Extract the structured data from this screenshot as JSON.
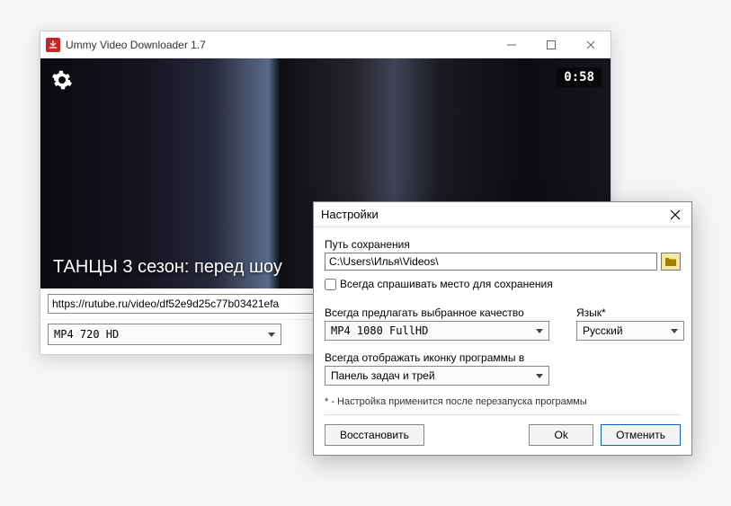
{
  "main": {
    "title": "Ummy Video Downloader 1.7",
    "video_timer": "0:58",
    "video_caption": "ТАНЦЫ 3 сезон: перед шоу",
    "url": "https://rutube.ru/video/df52e9d25c77b03421efa",
    "format_selected": "MP4  720  HD"
  },
  "settings": {
    "title": "Настройки",
    "path_label": "Путь сохранения",
    "path_value": "C:\\Users\\Илья\\Videos\\",
    "ask_checkbox_label": "Всегда спрашивать место для сохранения",
    "quality_label": "Всегда предлагать выбранное качество",
    "quality_value": "MP4  1080  FullHD",
    "lang_label": "Язык*",
    "lang_value": "Русский",
    "tray_label": "Всегда отображать иконку программы в",
    "tray_value": "Панель задач и трей",
    "note": "* - Настройка применится после перезапуска программы",
    "restore": "Восстановить",
    "ok": "Ok",
    "cancel": "Отменить"
  }
}
